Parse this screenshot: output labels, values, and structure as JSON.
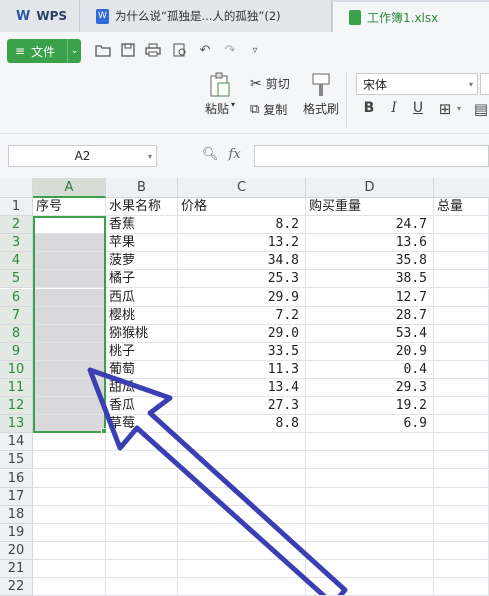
{
  "tabs": {
    "wps_label": "WPS",
    "doc_title": "为什么说“孤独是...人的孤独”(2)",
    "workbook_title": "工作簿1.xlsx"
  },
  "toolbar": {
    "file_label": "文件"
  },
  "ribbon": {
    "paste_label": "粘贴",
    "cut_label": "剪切",
    "copy_label": "复制",
    "format_painter_label": "格式刷",
    "font_name": "宋体",
    "bold": "B",
    "italic": "I",
    "underline": "U"
  },
  "formula_bar": {
    "cell_ref": "A2",
    "fx": "fx"
  },
  "sheet": {
    "columns": [
      "A",
      "B",
      "C",
      "D"
    ],
    "row_numbers": [
      "1",
      "2",
      "3",
      "4",
      "5",
      "6",
      "7",
      "8",
      "9",
      "10",
      "11",
      "12",
      "13",
      "14",
      "15",
      "16",
      "17",
      "18",
      "19",
      "20",
      "21",
      "22"
    ],
    "headers": {
      "a": "序号",
      "b": "水果名称",
      "c": "价格",
      "d": "购买重量",
      "e": "总量"
    },
    "rows": [
      {
        "name": "香蕉",
        "price": "8.2",
        "weight": "24.7"
      },
      {
        "name": "苹果",
        "price": "13.2",
        "weight": "13.6"
      },
      {
        "name": "菠萝",
        "price": "34.8",
        "weight": "35.8"
      },
      {
        "name": "橘子",
        "price": "25.3",
        "weight": "38.5"
      },
      {
        "name": "西瓜",
        "price": "29.9",
        "weight": "12.7"
      },
      {
        "name": "樱桃",
        "price": "7.2",
        "weight": "28.7"
      },
      {
        "name": "猕猴桃",
        "price": "29.0",
        "weight": "53.4"
      },
      {
        "name": "桃子",
        "price": "33.5",
        "weight": "20.9"
      },
      {
        "name": "葡萄",
        "price": "11.3",
        "weight": "0.4"
      },
      {
        "name": "甜瓜",
        "price": "13.4",
        "weight": "29.3"
      },
      {
        "name": "香瓜",
        "price": "27.3",
        "weight": "19.2"
      },
      {
        "name": "草莓",
        "price": "8.8",
        "weight": "6.9"
      }
    ]
  },
  "colors": {
    "accent": "#3aa04a",
    "annotation_arrow": "#3b3fb3"
  }
}
